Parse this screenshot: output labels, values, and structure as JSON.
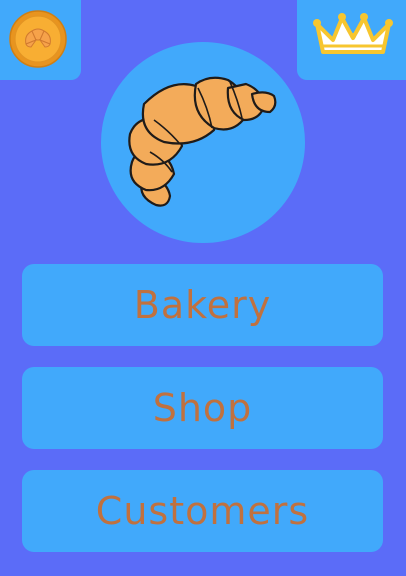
{
  "hud": {
    "coin_icon": "croissant-coin-icon",
    "crown_icon": "crown-icon"
  },
  "hero": {
    "icon": "croissant-icon"
  },
  "menu": {
    "items": [
      {
        "label": "Bakery"
      },
      {
        "label": "Shop"
      },
      {
        "label": "Customers"
      }
    ]
  },
  "colors": {
    "background": "#5b6cf8",
    "panel": "#41a9fb",
    "button_text": "#c0713f",
    "coin": "#f5a623",
    "crown": "#f7c62f"
  }
}
